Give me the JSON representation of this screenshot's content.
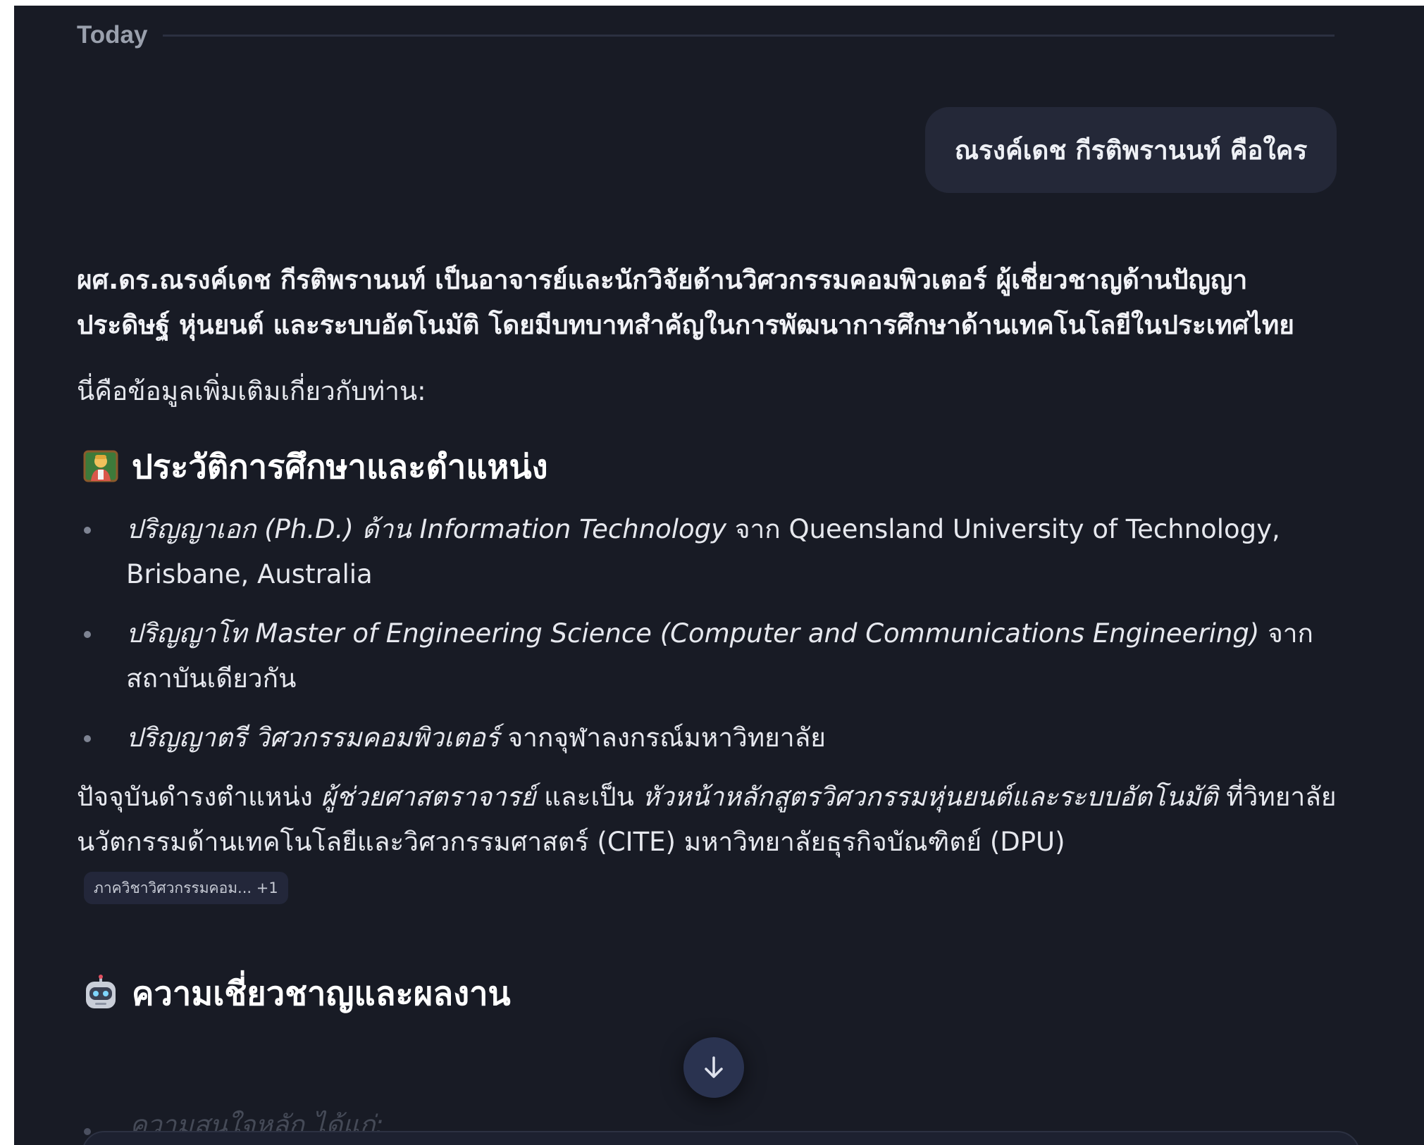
{
  "date_separator": "Today",
  "user_message": "ณรงค์เดช กีรติพรานนท์ คือใคร",
  "assistant": {
    "intro_bold": "ผศ.ดร.ณรงค์เดช กีรติพรานนท์ เป็นอาจารย์และนักวิจัยด้านวิศวกรรมคอมพิวเตอร์ ผู้เชี่ยวชาญด้านปัญญาประดิษฐ์ หุ่นยนต์ และระบบอัตโนมัติ โดยมีบทบาทสำคัญในการพัฒนาการศึกษาด้านเทคโนโลยีในประเทศไทย",
    "more_info": "นี่คือข้อมูลเพิ่มเติมเกี่ยวกับท่าน:",
    "section1": {
      "icon": "teacher-emoji",
      "title": "ประวัติการศึกษาและตำแหน่ง",
      "items": [
        {
          "em": "ปริญญาเอก (Ph.D.) ด้าน Information Technology",
          "rest": " จาก Queensland University of Technology, Brisbane, Australia"
        },
        {
          "em": "ปริญญาโท Master of Engineering Science (Computer and Communications Engineering)",
          "rest": " จาก สถาบันเดียวกัน"
        },
        {
          "em": "ปริญญาตรี วิศวกรรมคอมพิวเตอร์",
          "rest": " จากจุฬาลงกรณ์มหาวิทยาลัย"
        }
      ]
    },
    "position_text": {
      "before": "ปัจจุบันดำรงตำแหน่ง ",
      "em1": "ผู้ช่วยศาสตราจารย์",
      "middle": " และเป็น ",
      "em2": "หัวหน้าหลักสูตรวิศวกรรมหุ่นยนต์และระบบอัตโนมัติ",
      "after": " ที่วิทยาลัยนวัตกรรมด้านเทคโนโลยีและวิศวกรรมศาสตร์ (CITE) มหาวิทยาลัยธุรกิจบัณฑิตย์ (DPU)"
    },
    "source_chip": "ภาควิชาวิศวกรรมคอม... +1",
    "section2": {
      "icon": "robot-emoji",
      "title": "ความเชี่ยวชาญและผลงาน"
    },
    "faded_item": "ความสนใจหลัก ได้แก่:"
  },
  "scroll_button_icon": "arrow-down-icon"
}
